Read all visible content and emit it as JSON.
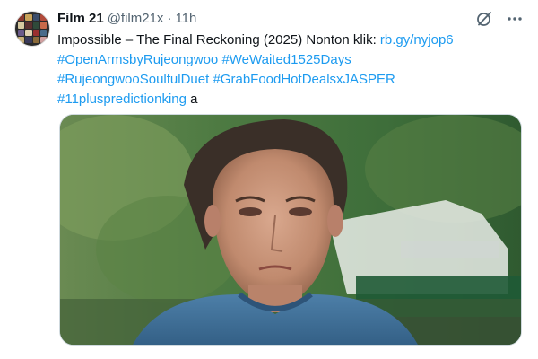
{
  "author": {
    "display_name": "Film 21",
    "handle": "@film21x",
    "separator": "·",
    "time": "11h"
  },
  "tweet": {
    "text_prefix": "Impossible – The Final Reckoning (2025) Nonton klik: ",
    "link": "rb.gy/nyjop6",
    "hashtags": [
      "#OpenArmsbyRujeongwoo",
      "#WeWaited1525Days",
      "#RujeongwooSoulfulDuet",
      "#GrabFoodHotDealsxJASPER",
      "#11pluspredictionking"
    ],
    "text_suffix": " a"
  },
  "icons": {
    "grok": "grok-icon",
    "more": "more-icon",
    "avatar": "avatar"
  },
  "colors": {
    "link": "#1d9bf0",
    "secondary_text": "#536471",
    "primary_text": "#0f1419"
  }
}
